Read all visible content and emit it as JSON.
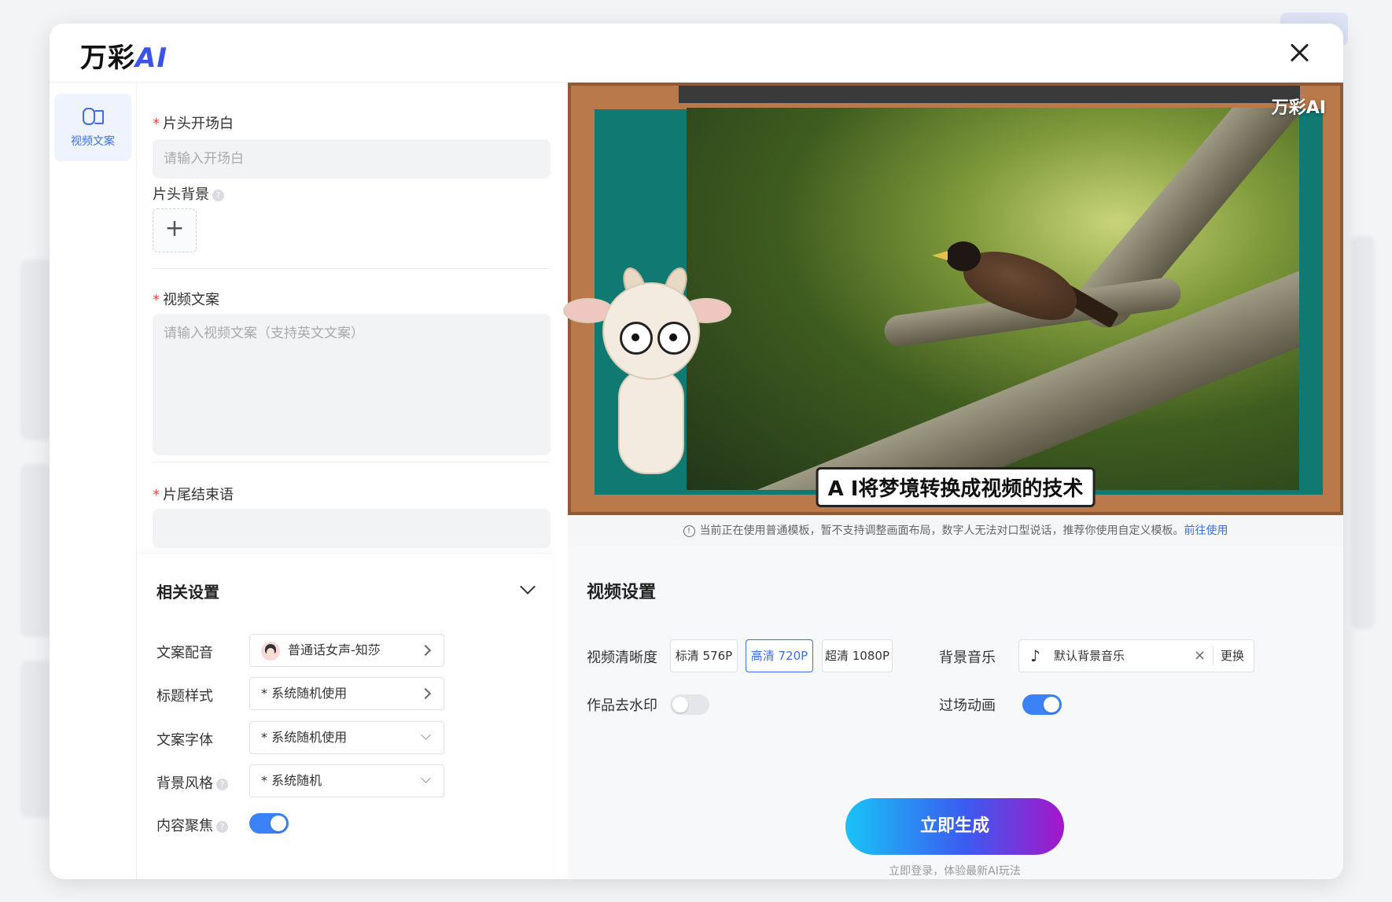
{
  "logo": {
    "text": "万彩",
    "ai": "AI"
  },
  "rail": {
    "items": [
      {
        "label": "视频文案"
      }
    ]
  },
  "form": {
    "opening": {
      "label": "片头开场白",
      "placeholder": "请输入开场白"
    },
    "bg": {
      "label": "片头背景"
    },
    "script": {
      "label": "视频文案",
      "placeholder": "请输入视频文案（支持英文文案）"
    },
    "ending": {
      "label": "片尾结束语"
    }
  },
  "settings": {
    "title": "相关设置",
    "voice": {
      "label": "文案配音",
      "value": "普通话女声-知莎"
    },
    "title_style": {
      "label": "标题样式",
      "value": "* 系统随机使用"
    },
    "font": {
      "label": "文案字体",
      "value": "* 系统随机使用"
    },
    "bg_style": {
      "label": "背景风格",
      "value": "* 系统随机"
    },
    "focus": {
      "label": "内容聚焦",
      "on": true
    }
  },
  "preview": {
    "watermark": "万彩AI",
    "subtitle": "A I将梦境转换成视频的技术"
  },
  "notice": {
    "text": "当前正在使用普通模板，暂不支持调整画面布局，数字人无法对口型说话，推荐你使用自定义模板。",
    "link": "前往使用"
  },
  "video_settings": {
    "title": "视频设置",
    "resolution": {
      "label": "视频清晰度",
      "options": [
        "标清 576P",
        "高清 720P",
        "超清 1080P"
      ],
      "selected": "高清 720P"
    },
    "music": {
      "label": "背景音乐",
      "value": "默认背景音乐",
      "change": "更换",
      "clear": "×"
    },
    "watermark": {
      "label": "作品去水印",
      "on": false
    },
    "transition": {
      "label": "过场动画",
      "on": true
    },
    "generate": "立即生成",
    "generate_sub": "立即登录，体验最新AI玩法"
  },
  "colors": {
    "accent": "#3b6ee8",
    "required": "#e74c3c",
    "teal": "#0f7972"
  }
}
